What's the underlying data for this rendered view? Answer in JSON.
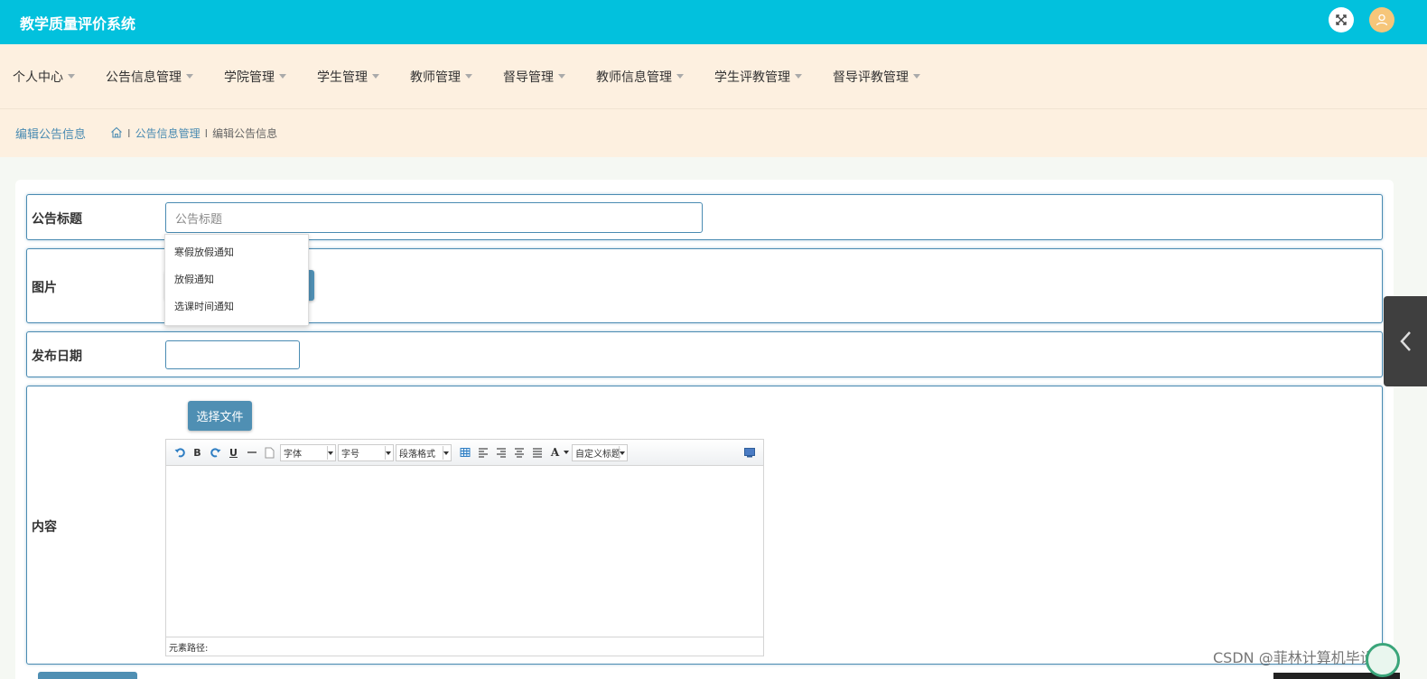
{
  "header": {
    "title": "教学质量评价系统"
  },
  "nav": {
    "items": [
      {
        "label": "个人中心"
      },
      {
        "label": "公告信息管理"
      },
      {
        "label": "学院管理"
      },
      {
        "label": "学生管理"
      },
      {
        "label": "教师管理"
      },
      {
        "label": "督导管理"
      },
      {
        "label": "教师信息管理"
      },
      {
        "label": "学生评教管理"
      },
      {
        "label": "督导评教管理"
      }
    ]
  },
  "breadcrumb": {
    "page_title": "编辑公告信息",
    "sep": "I",
    "items": [
      "公告信息管理",
      "编辑公告信息"
    ]
  },
  "form": {
    "title_label": "公告标题",
    "title_placeholder": "公告标题",
    "image_label": "图片",
    "date_label": "发布日期",
    "date_value": "",
    "content_label": "内容",
    "file_button": "选择文件"
  },
  "autocomplete": {
    "options": [
      "寒假放假通知",
      "放假通知",
      "选课时间通知"
    ]
  },
  "editor": {
    "font_family": "字体",
    "font_size": "字号",
    "paragraph": "段落格式",
    "custom_title": "自定义标题",
    "bold": "B",
    "underline": "U",
    "font_color": "A",
    "status_path": "元素路径:"
  },
  "watermark": "CSDN @菲林计算机毕设",
  "colors": {
    "header_bg": "#02c1dd",
    "nav_bg": "#fdf0e0",
    "accent": "#4a8bb2",
    "button_bg": "#4f8fb3"
  }
}
